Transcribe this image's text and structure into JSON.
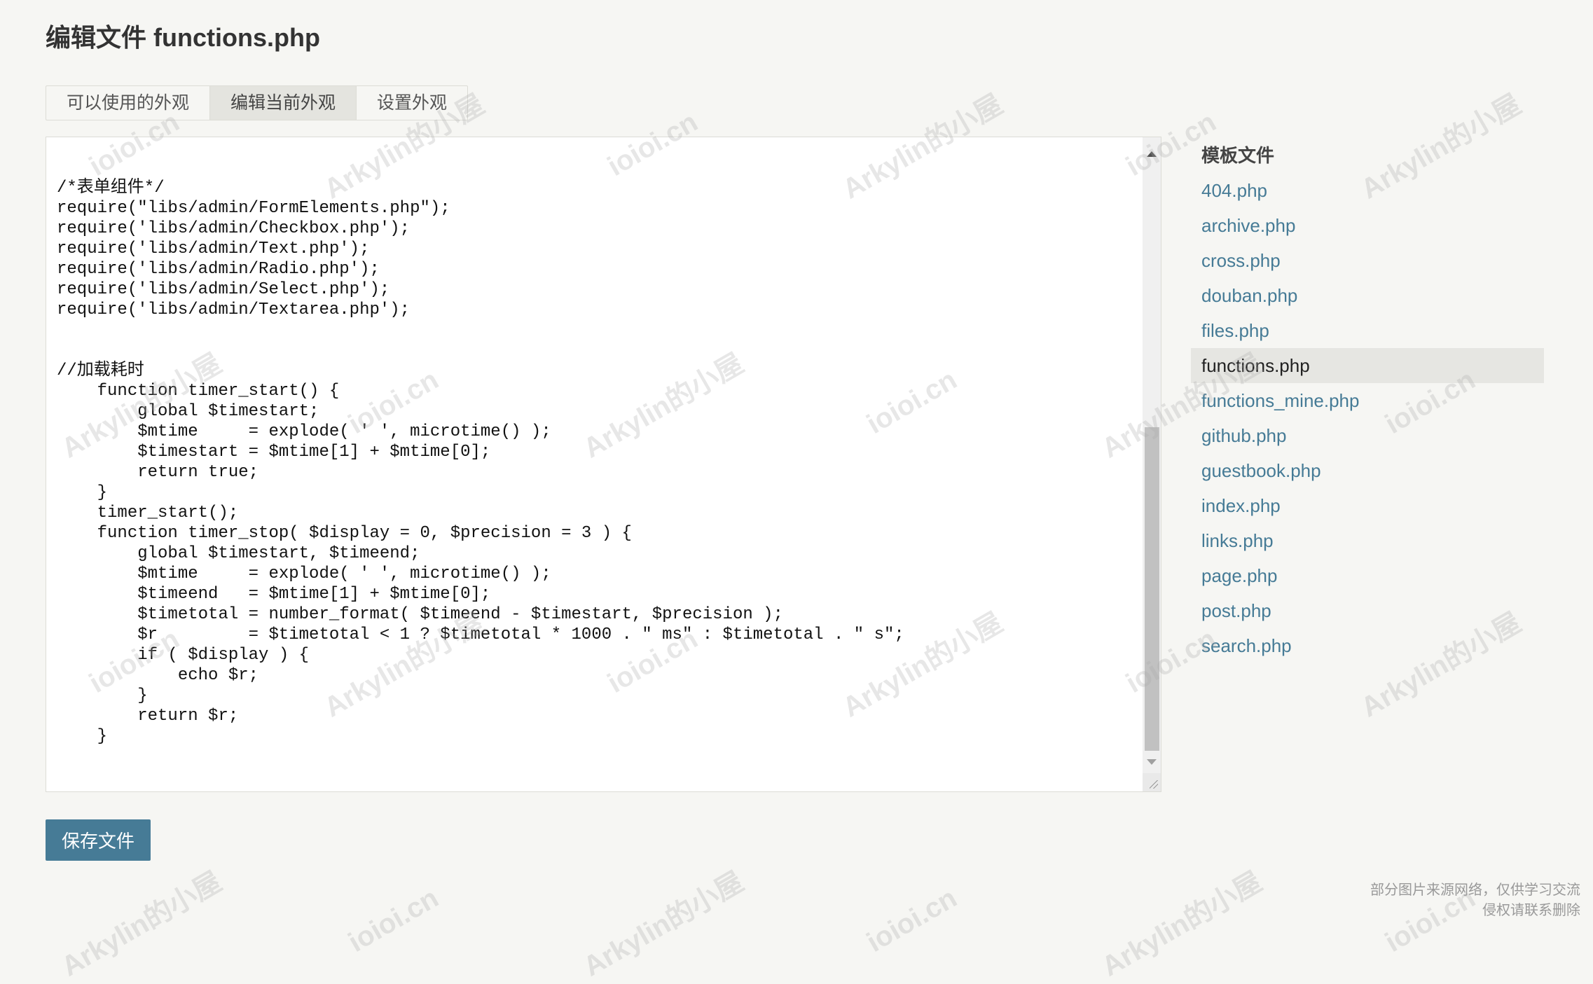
{
  "page": {
    "title": "编辑文件 functions.php"
  },
  "tabs": [
    {
      "label": "可以使用的外观",
      "active": false
    },
    {
      "label": "编辑当前外观",
      "active": true
    },
    {
      "label": "设置外观",
      "active": false
    }
  ],
  "editor": {
    "lines": [
      "",
      "",
      "/*表单组件*/",
      "require(\"libs/admin/FormElements.php\");",
      "require('libs/admin/Checkbox.php');",
      "require('libs/admin/Text.php');",
      "require('libs/admin/Radio.php');",
      "require('libs/admin/Select.php');",
      "require('libs/admin/Textarea.php');",
      "",
      "",
      "//加载耗时",
      "    function timer_start() {",
      "        global $timestart;",
      "        $mtime     = explode( ' ', microtime() );",
      "        $timestart = $mtime[1] + $mtime[0];",
      "        return true;",
      "    }",
      "    timer_start();",
      "    function timer_stop( $display = 0, $precision = 3 ) {",
      "        global $timestart, $timeend;",
      "        $mtime     = explode( ' ', microtime() );",
      "        $timeend   = $mtime[1] + $mtime[0];",
      "        $timetotal = number_format( $timeend - $timestart, $precision );",
      "        $r         = $timetotal < 1 ? $timetotal * 1000 . \" ms\" : $timetotal . \" s\";",
      "        if ( $display ) {",
      "            echo $r;",
      "        }",
      "        return $r;",
      "    }"
    ]
  },
  "sidebar": {
    "heading": "模板文件",
    "files": [
      {
        "label": "404.php",
        "current": false
      },
      {
        "label": "archive.php",
        "current": false
      },
      {
        "label": "cross.php",
        "current": false
      },
      {
        "label": "douban.php",
        "current": false
      },
      {
        "label": "files.php",
        "current": false
      },
      {
        "label": "functions.php",
        "current": true
      },
      {
        "label": "functions_mine.php",
        "current": false
      },
      {
        "label": "github.php",
        "current": false
      },
      {
        "label": "guestbook.php",
        "current": false
      },
      {
        "label": "index.php",
        "current": false
      },
      {
        "label": "links.php",
        "current": false
      },
      {
        "label": "page.php",
        "current": false
      },
      {
        "label": "post.php",
        "current": false
      },
      {
        "label": "search.php",
        "current": false
      }
    ]
  },
  "actions": {
    "save_label": "保存文件"
  },
  "footer": {
    "line1": "部分图片来源网络，仅供学习交流",
    "line2": "侵权请联系删除"
  },
  "watermarks": {
    "brand": "Arkylin的小屋",
    "domain": "ioioi.cn"
  },
  "colors": {
    "accent": "#467b96",
    "background": "#f6f6f3",
    "active_tab": "#e4e4df",
    "current_file_bg": "#e6e6e2"
  }
}
